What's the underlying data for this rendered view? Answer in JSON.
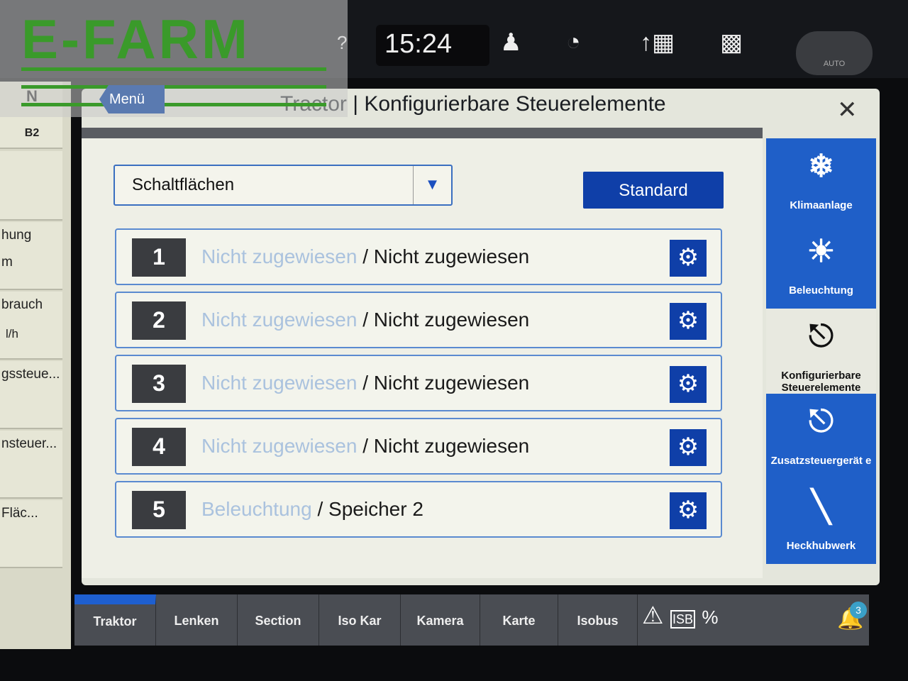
{
  "watermark": "E-FARM",
  "topbar": {
    "time": "15:24",
    "auto_label": "AUTO",
    "icons": [
      "help-icon",
      "user-icon",
      "speedometer-icon",
      "implement-icon",
      "field-icon"
    ]
  },
  "left_panel": {
    "gear": "N",
    "range": "B2",
    "items": [
      "hung",
      "m",
      "brauch",
      "l/h",
      "gssteue...",
      "nsteuer...",
      "Fläc..."
    ]
  },
  "header": {
    "menu_label": "Menü",
    "title": "Tractor | Konfigurierbare Steuerelemente"
  },
  "main": {
    "dropdown_value": "Schaltflächen",
    "standard_label": "Standard",
    "rows": [
      {
        "num": "1",
        "first": "Nicht zugewiesen",
        "second": "/ Nicht zugewiesen"
      },
      {
        "num": "2",
        "first": "Nicht zugewiesen",
        "second": "/ Nicht zugewiesen"
      },
      {
        "num": "3",
        "first": "Nicht zugewiesen",
        "second": "/ Nicht zugewiesen"
      },
      {
        "num": "4",
        "first": "Nicht zugewiesen",
        "second": "/ Nicht zugewiesen"
      },
      {
        "num": "5",
        "first": "Beleuchtung",
        "second": "/ Speicher 2"
      }
    ]
  },
  "sidebar": [
    {
      "label": "Klimaanlage",
      "icon": "climate-icon",
      "active": false
    },
    {
      "label": "Beleuchtung",
      "icon": "light-icon",
      "active": false
    },
    {
      "label": "Konfigurierbare Steuerelemente",
      "icon": "joystick-icon",
      "active": true
    },
    {
      "label": "Zusatzsteuergerät e",
      "icon": "hydraulic-icon",
      "active": false
    },
    {
      "label": "Heckhubwerk",
      "icon": "hitch-icon",
      "active": false
    }
  ],
  "bottom_tabs": [
    "Traktor",
    "Lenken",
    "Section",
    "Iso Kar",
    "Kamera",
    "Karte",
    "Isobus"
  ],
  "notifications": "3",
  "colors": {
    "accent": "#0f3fa8",
    "active_tab": "#1e5fd0"
  }
}
